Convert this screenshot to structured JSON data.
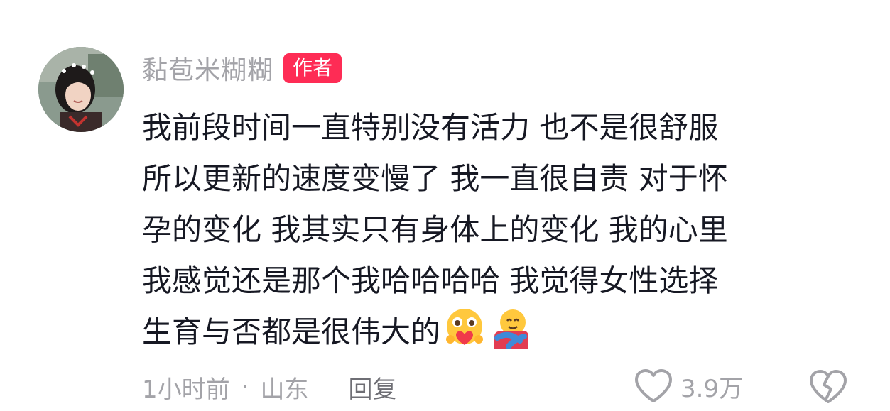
{
  "comment": {
    "username": "黏苞米糊糊",
    "author_badge": "作者",
    "text": "我前段时间一直特别没有活力 也不是很舒服\n所以更新的速度变慢了 我一直很自责 对于怀\n孕的变化 我其实只有身体上的变化 我的心里\n我感觉还是那个我哈哈哈哈 我觉得女性选择\n生育与否都是很伟大的",
    "emojis": [
      "heart-eyes-hug-emoji",
      "hugging-face-emoji"
    ],
    "time": "1小时前",
    "separator": "·",
    "location": "山东",
    "reply_label": "回复",
    "like_count": "3.9万"
  },
  "colors": {
    "badge": "#fe2c55",
    "text": "#161823",
    "meta": "#a3a3a8"
  },
  "icons": {
    "like": "heart-outline-icon",
    "dislike": "broken-heart-icon"
  }
}
